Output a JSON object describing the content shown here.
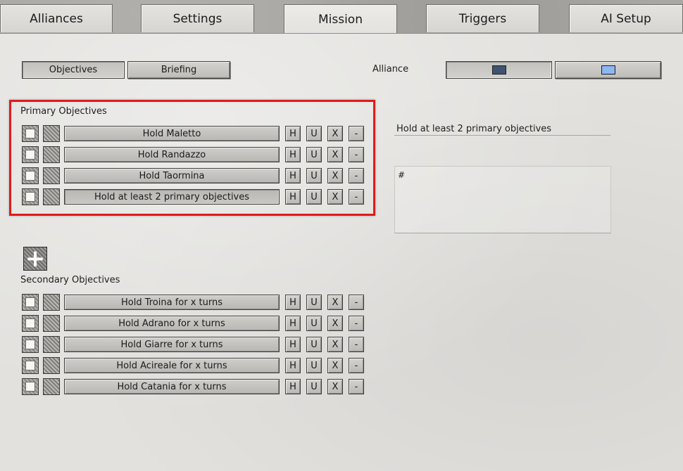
{
  "tabs": [
    {
      "label": "Alliances",
      "active": false
    },
    {
      "label": "Settings",
      "active": false
    },
    {
      "label": "Mission",
      "active": true
    },
    {
      "label": "Triggers",
      "active": false
    },
    {
      "label": "AI Setup",
      "active": false
    }
  ],
  "subtabs": {
    "objectives": "Objectives",
    "briefing": "Briefing"
  },
  "alliance": {
    "label": "Alliance",
    "colors": [
      "#3e5470",
      "#8db6f2"
    ]
  },
  "primary": {
    "title": "Primary Objectives",
    "items": [
      {
        "label": "Hold Maletto"
      },
      {
        "label": "Hold Randazzo"
      },
      {
        "label": "Hold Taormina"
      },
      {
        "label": "Hold at least 2 primary objectives"
      }
    ]
  },
  "secondary": {
    "title": "Secondary Objectives",
    "items": [
      {
        "label": "Hold Troina for x turns"
      },
      {
        "label": "Hold Adrano for x turns"
      },
      {
        "label": "Hold Giarre for x turns"
      },
      {
        "label": "Hold Acireale for x turns"
      },
      {
        "label": "Hold Catania for x turns"
      }
    ]
  },
  "row_buttons": {
    "h": "H",
    "u": "U",
    "x": "X",
    "remove": "-"
  },
  "add_button": {
    "glyph": "+"
  },
  "detail": {
    "name_value": "Hold at least 2 primary objectives",
    "text_value": "#"
  },
  "highlight_color": "#e01b1b"
}
